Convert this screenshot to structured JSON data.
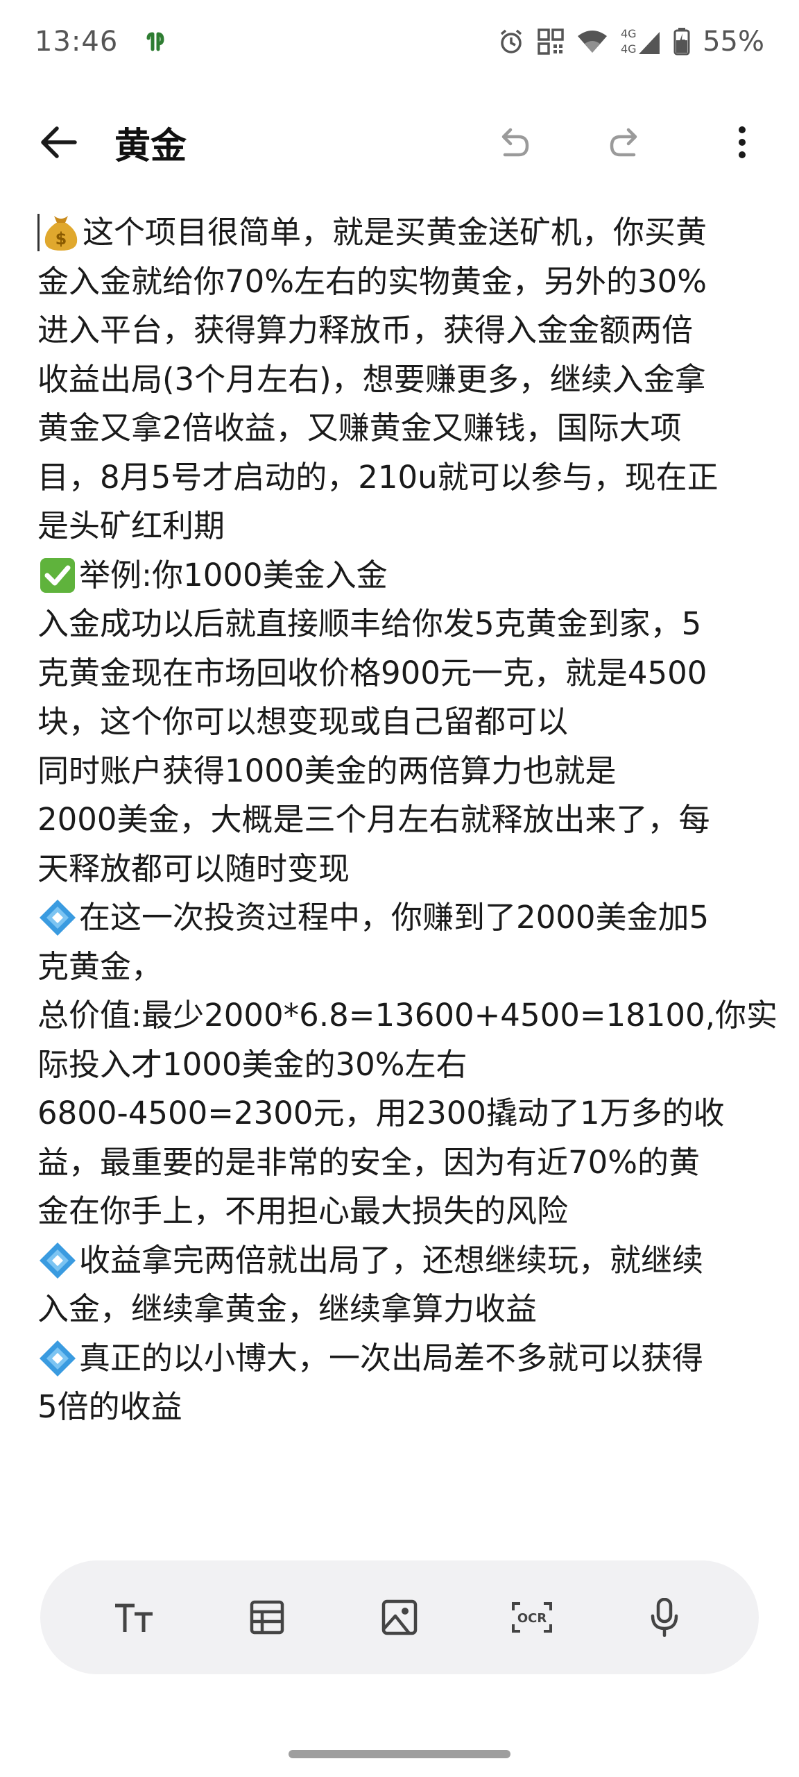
{
  "status_bar": {
    "time": "13:46",
    "network": "4G",
    "battery": "55%",
    "icons": [
      "app-notification-icon",
      "alarm-icon",
      "qr-icon",
      "wifi-icon",
      "signal-icon",
      "battery-icon"
    ]
  },
  "toolbar": {
    "title": "黄金",
    "icons": [
      "back-arrow-icon",
      "undo-icon",
      "redo-icon",
      "more-vertical-icon"
    ]
  },
  "note": {
    "lines": [
      {
        "emoji": "money-bag",
        "text": "这个项目很简单，就是买黄金送矿机，你买黄"
      },
      {
        "text": "金入金就给你70%左右的实物黄金，另外的30%"
      },
      {
        "text": "进入平台，获得算力释放币，获得入金金额两倍"
      },
      {
        "text": "收益出局(3个月左右)，想要赚更多，继续入金拿"
      },
      {
        "text": "黄金又拿2倍收益，又赚黄金又赚钱，国际大项"
      },
      {
        "text": "目，8月5号才启动的，210u就可以参与，现在正"
      },
      {
        "text": "是头矿红利期"
      },
      {
        "emoji": "check",
        "text": "举例:你1000美金入金"
      },
      {
        "text": "入金成功以后就直接顺丰给你发5克黄金到家，5"
      },
      {
        "text": "克黄金现在市场回收价格900元一克，就是4500"
      },
      {
        "text": "块，这个你可以想变现或自己留都可以"
      },
      {
        "text": "同时账户获得1000美金的两倍算力也就是"
      },
      {
        "text": "2000美金，大概是三个月左右就释放出来了，每"
      },
      {
        "text": "天释放都可以随时变现"
      },
      {
        "emoji": "diamond",
        "text": "在这一次投资过程中，你赚到了2000美金加5"
      },
      {
        "text": "克黄金，"
      },
      {
        "text": "总价值:最少2000*6.8=13600+4500=18100,你实"
      },
      {
        "text": "际投入才1000美金的30%左右"
      },
      {
        "text": "6800-4500=2300元，用2300撬动了1万多的收"
      },
      {
        "text": "益，最重要的是非常的安全，因为有近70%的黄"
      },
      {
        "text": "金在你手上，不用担心最大损失的风险"
      },
      {
        "emoji": "diamond",
        "text": "收益拿完两倍就出局了，还想继续玩，就继续"
      },
      {
        "text": "入金，继续拿黄金，继续拿算力收益"
      },
      {
        "emoji": "diamond",
        "text": "真正的以小博大，一次出局差不多就可以获得"
      },
      {
        "text": "5倍的收益"
      }
    ]
  },
  "format_bar": {
    "tools": [
      "text-format-icon",
      "table-icon",
      "image-icon",
      "ocr-icon",
      "microphone-icon"
    ],
    "ocr_label": "OCR"
  }
}
